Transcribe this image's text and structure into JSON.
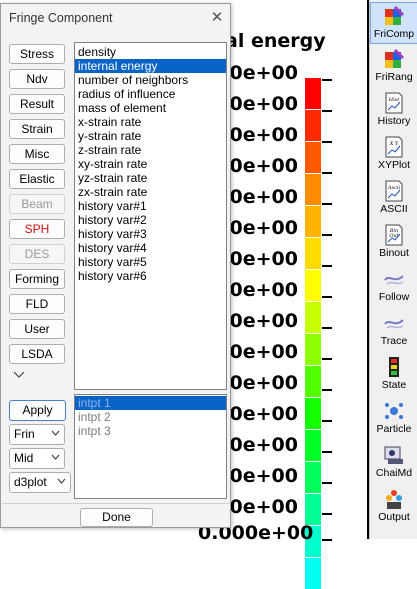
{
  "plot": {
    "title": "al energy",
    "tick_labels": [
      "000e+00",
      "000e+00",
      "000e+00",
      "000e+00",
      "000e+00",
      "000e+00",
      "000e+00",
      "000e+00",
      "000e+00",
      "000e+00",
      "000e+00",
      "000e+00",
      "000e+00",
      "000e+00",
      "000e+00",
      "0.000e+00"
    ],
    "colorbar_colors": [
      "#ff0000",
      "#ff2a00",
      "#ff5a00",
      "#ff8c00",
      "#ffb400",
      "#ffdc00",
      "#ffff00",
      "#c8ff00",
      "#8cff00",
      "#50ff00",
      "#14ff00",
      "#00ff28",
      "#00ff5a",
      "#00ff96",
      "#00ffcc",
      "#00fff0"
    ]
  },
  "dialog": {
    "title": "Fringe Component",
    "side_buttons": [
      {
        "label": "Stress",
        "state": "normal"
      },
      {
        "label": "Ndv",
        "state": "normal"
      },
      {
        "label": "Result",
        "state": "normal"
      },
      {
        "label": "Strain",
        "state": "normal"
      },
      {
        "label": "Misc",
        "state": "normal"
      },
      {
        "label": "Elastic",
        "state": "normal"
      },
      {
        "label": "Beam",
        "state": "disabled"
      },
      {
        "label": "SPH",
        "state": "red"
      },
      {
        "label": "DES",
        "state": "disabled"
      },
      {
        "label": "Forming",
        "state": "normal"
      },
      {
        "label": "FLD",
        "state": "normal"
      },
      {
        "label": "User",
        "state": "normal"
      },
      {
        "label": "LSDA",
        "state": "normal"
      }
    ],
    "components": [
      "density",
      "internal energy",
      "number of neighbors",
      "radius of influence",
      "mass of element",
      "x-strain rate",
      "y-strain rate",
      "z-strain rate",
      "xy-strain rate",
      "yz-strain rate",
      "zx-strain rate",
      "history var#1",
      "history var#2",
      "history var#3",
      "history var#4",
      "history var#5",
      "history var#6"
    ],
    "selected_component": "internal energy",
    "intpts": [
      "intpt  1",
      "intpt  2",
      "intpt  3"
    ],
    "selected_intpt": "intpt  1",
    "apply_label": "Apply",
    "select_frin": "Frin",
    "select_mid": "Mid",
    "select_d3plot": "d3plot",
    "done_label": "Done"
  },
  "toolbar": {
    "items": [
      {
        "label": "FriComp",
        "icon": "fringe-component-icon",
        "active": true
      },
      {
        "label": "FriRang",
        "icon": "fringe-range-icon",
        "active": false
      },
      {
        "label": "History",
        "icon": "history-icon",
        "active": false
      },
      {
        "label": "XYPlot",
        "icon": "xyplot-icon",
        "active": false
      },
      {
        "label": "ASCII",
        "icon": "ascii-icon",
        "active": false
      },
      {
        "label": "Binout",
        "icon": "binout-icon",
        "active": false
      },
      {
        "label": "Follow",
        "icon": "follow-icon",
        "active": false
      },
      {
        "label": "Trace",
        "icon": "trace-icon",
        "active": false
      },
      {
        "label": "State",
        "icon": "state-icon",
        "active": false
      },
      {
        "label": "Particle",
        "icon": "particle-icon",
        "active": false
      },
      {
        "label": "ChaiMd",
        "icon": "chaimd-icon",
        "active": false
      },
      {
        "label": "Output",
        "icon": "output-icon",
        "active": false
      }
    ],
    "icon_glyphs": {
      "history": "Hist",
      "xyplot": "X Y",
      "ascii": "Ascii",
      "binout": "Bin Out"
    }
  }
}
